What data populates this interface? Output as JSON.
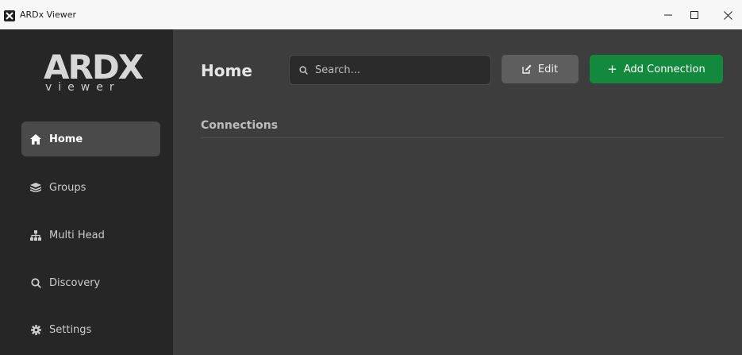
{
  "window": {
    "title": "ARDx Viewer",
    "controls": {
      "minimize": "–",
      "maximize": "□",
      "close": "✕"
    }
  },
  "logo": {
    "word": "ARDX",
    "sub": "viewer"
  },
  "sidebar": {
    "items": [
      {
        "label": "Home",
        "icon": "home-icon",
        "active": true
      },
      {
        "label": "Groups",
        "icon": "layers-icon",
        "active": false
      },
      {
        "label": "Multi Head",
        "icon": "sitemap-icon",
        "active": false
      },
      {
        "label": "Discovery",
        "icon": "search-icon",
        "active": false
      },
      {
        "label": "Settings",
        "icon": "gear-icon",
        "active": false
      }
    ]
  },
  "header": {
    "title": "Home",
    "search_placeholder": "Search...",
    "edit_label": "Edit",
    "add_label": "Add Connection",
    "add_plus": "+"
  },
  "main": {
    "section_title": "Connections"
  },
  "colors": {
    "sidebar_bg": "#262626",
    "main_bg": "#3d3d3d",
    "active_item_bg": "#4a4a4a",
    "edit_button_bg": "#5e5e5e",
    "add_button_bg": "#12893d"
  }
}
